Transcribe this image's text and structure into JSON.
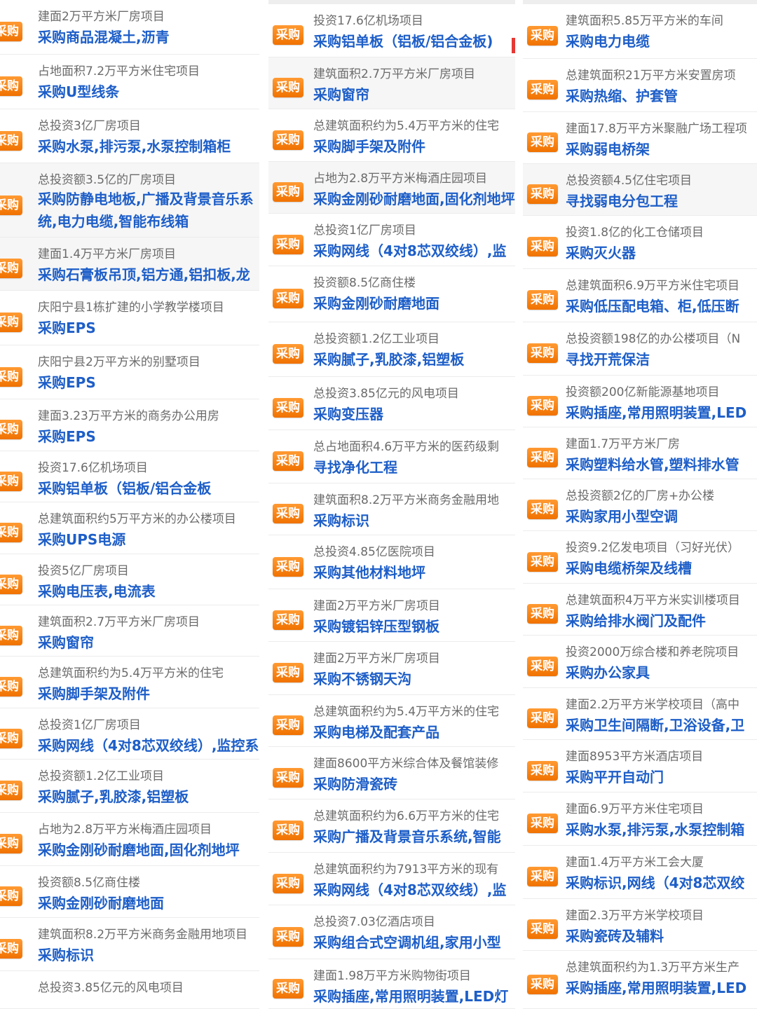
{
  "badge_label": "采购",
  "accent_color": "#f07f1a",
  "title_color": "#1d5ec8",
  "columns": [
    {
      "items": [
        {
          "desc": "建面2万平方米厂房项目",
          "title": "采购商品混凝土,沥青"
        },
        {
          "desc": "占地面积7.2万平方米住宅项目",
          "title": "采购U型线条"
        },
        {
          "desc": "总投资3亿厂房项目",
          "title": "采购水泵,排污泵,水泵控制箱柜"
        },
        {
          "desc": "总投资额3.5亿的厂房项目",
          "title": "采购防静电地板,广播及背景音乐系统,电力电缆,智能布线箱"
        },
        {
          "desc": "建面1.4万平方米厂房项目",
          "title": "采购石膏板吊顶,铝方通,铝扣板,龙"
        },
        {
          "desc": "庆阳宁县1栋扩建的小学教学楼项目",
          "title": "采购EPS"
        },
        {
          "desc": "庆阳宁县2万平方米的别墅项目",
          "title": "采购EPS"
        },
        {
          "desc": "建面3.23万平方米的商务办公用房",
          "title": "采购EPS"
        },
        {
          "desc": "投资17.6亿机场项目",
          "title": "采购铝单板（铝板/铝合金板"
        },
        {
          "desc": "总建筑面积约5万平方米的办公楼项目",
          "title": "采购UPS电源"
        },
        {
          "desc": "投资5亿厂房项目",
          "title": "采购电压表,电流表"
        },
        {
          "desc": "建筑面积2.7万平方米厂房项目",
          "title": "采购窗帘"
        },
        {
          "desc": "总建筑面积约为5.4万平方米的住宅",
          "title": "采购脚手架及附件"
        },
        {
          "desc": "总投资1亿厂房项目",
          "title": "采购网线（4对8芯双绞线）,监控系"
        },
        {
          "desc": "总投资额1.2亿工业项目",
          "title": "采购腻子,乳胶漆,铝塑板"
        },
        {
          "desc": "占地为2.8万平方米梅酒庄园项目",
          "title": "采购金刚砂耐磨地面,固化剂地坪"
        },
        {
          "desc": "投资额8.5亿商住楼",
          "title": "采购金刚砂耐磨地面"
        },
        {
          "desc": "建筑面积8.2万平方米商务金融用地项目",
          "title": "采购标识"
        },
        {
          "desc": "总投资3.85亿元的风电项目",
          "title": ""
        }
      ]
    },
    {
      "items": [
        {
          "desc": "投资17.6亿机场项目",
          "title": "采购铝单板（铝板/铝合金板)"
        },
        {
          "desc": "建筑面积2.7万平方米厂房项目",
          "title": "采购窗帘"
        },
        {
          "desc": "总建筑面积约为5.4万平方米的住宅",
          "title": "采购脚手架及附件"
        },
        {
          "desc": "占地为2.8万平方米梅酒庄园项目",
          "title": "采购金刚砂耐磨地面,固化剂地坪"
        },
        {
          "desc": "总投资1亿厂房项目",
          "title": "采购网线（4对8芯双绞线）,监"
        },
        {
          "desc": "投资额8.5亿商住楼",
          "title": "采购金刚砂耐磨地面"
        },
        {
          "desc": "总投资额1.2亿工业项目",
          "title": "采购腻子,乳胶漆,铝塑板"
        },
        {
          "desc": "总投资3.85亿元的风电项目",
          "title": "采购变压器"
        },
        {
          "desc": "总占地面积4.6万平方米的医药级剩",
          "title": "寻找净化工程"
        },
        {
          "desc": "建筑面积8.2万平方米商务金融用地",
          "title": "采购标识"
        },
        {
          "desc": "总投资4.85亿医院项目",
          "title": "采购其他材料地坪"
        },
        {
          "desc": "建面2万平方米厂房项目",
          "title": "采购镀铝锌压型钢板"
        },
        {
          "desc": "建面2万平方米厂房项目",
          "title": "采购不锈钢天沟"
        },
        {
          "desc": "总建筑面积约为5.4万平方米的住宅",
          "title": "采购电梯及配套产品"
        },
        {
          "desc": "建面8600平方米综合体及餐馆装修",
          "title": "采购防滑瓷砖"
        },
        {
          "desc": "总建筑面积约为6.6万平方米的住宅",
          "title": "采购广播及背景音乐系统,智能"
        },
        {
          "desc": "总建筑面积约为7913平方米的现有",
          "title": "采购网线（4对8芯双绞线）,监"
        },
        {
          "desc": "总投资7.03亿酒店项目",
          "title": "采购组合式空调机组,家用小型"
        },
        {
          "desc": "建面1.98万平方米购物街项目",
          "title": "采购插座,常用照明装置,LED灯"
        }
      ]
    },
    {
      "items": [
        {
          "desc": "建筑面积5.85万平方米的车间",
          "title": "采购电力电缆"
        },
        {
          "desc": "总建筑面积21万平方米安置房项",
          "title": "采购热缩、护套管"
        },
        {
          "desc": "建面17.8万平方米聚融广场工程项",
          "title": "采购弱电桥架"
        },
        {
          "desc": "总投资额4.5亿住宅项目",
          "title": "寻找弱电分包工程"
        },
        {
          "desc": "投资1.8亿的化工仓储项目",
          "title": "采购灭火器"
        },
        {
          "desc": "总建筑面积6.9万平方米住宅项目",
          "title": "采购低压配电箱、柜,低压断"
        },
        {
          "desc": "总投资额198亿的办公楼项目（N",
          "title": "寻找开荒保洁"
        },
        {
          "desc": "投资额200亿新能源基地项目",
          "title": "采购插座,常用照明装置,LED"
        },
        {
          "desc": "建面1.7万平方米厂房",
          "title": "采购塑料给水管,塑料排水管"
        },
        {
          "desc": "总投资额2亿的厂房+办公楼",
          "title": "采购家用小型空调"
        },
        {
          "desc": "投资9.2亿发电项目（习好光伏）",
          "title": "采购电缆桥架及线槽"
        },
        {
          "desc": "总建筑面积4万平方米实训楼项目",
          "title": "采购给排水阀门及配件"
        },
        {
          "desc": "投资2000万综合楼和养老院项目",
          "title": "采购办公家具"
        },
        {
          "desc": "建面2.2万平方米学校项目（高中",
          "title": "采购卫生间隔断,卫浴设备,卫"
        },
        {
          "desc": "建面8953平方米酒店项目",
          "title": "采购平开自动门"
        },
        {
          "desc": "建面6.9万平方米住宅项目",
          "title": "采购水泵,排污泵,水泵控制箱"
        },
        {
          "desc": "建面1.4万平方米工会大厦",
          "title": "采购标识,网线（4对8芯双绞"
        },
        {
          "desc": "建面2.3万平方米学校项目",
          "title": "采购瓷砖及辅料"
        },
        {
          "desc": "总建筑面积约为1.3万平方米生产",
          "title": "采购插座,常用照明装置,LED"
        }
      ]
    }
  ]
}
